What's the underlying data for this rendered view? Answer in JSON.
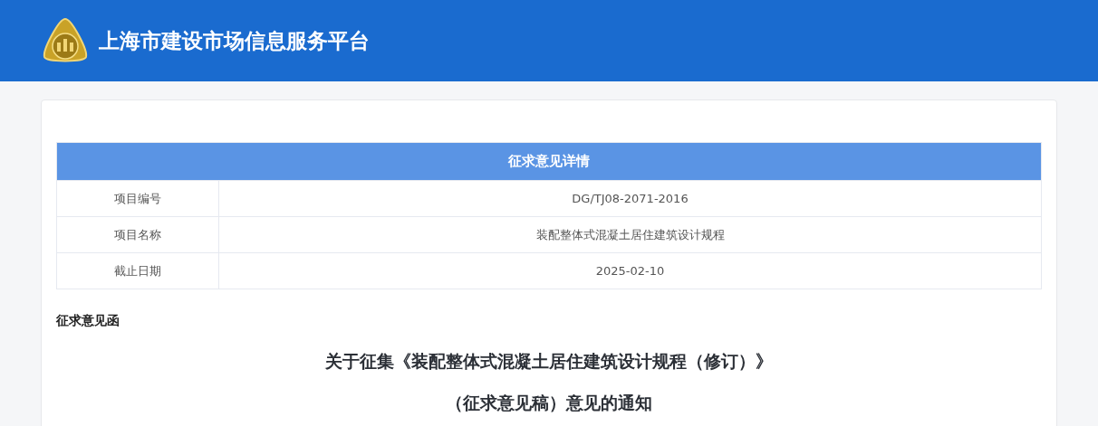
{
  "header": {
    "title": "上海市建设市场信息服务平台"
  },
  "details": {
    "title": "征求意见详情",
    "rows": [
      {
        "label": "项目编号",
        "value": "DG/TJ08-2071-2016"
      },
      {
        "label": "项目名称",
        "value": "装配整体式混凝土居住建筑设计规程"
      },
      {
        "label": "截止日期",
        "value": "2025-02-10"
      }
    ]
  },
  "letter": {
    "heading": "征求意见函",
    "title_lines": [
      "关于征集《装配整体式混凝土居住建筑设计规程（修订）》",
      "（征求意见稿）意见的通知"
    ]
  }
}
